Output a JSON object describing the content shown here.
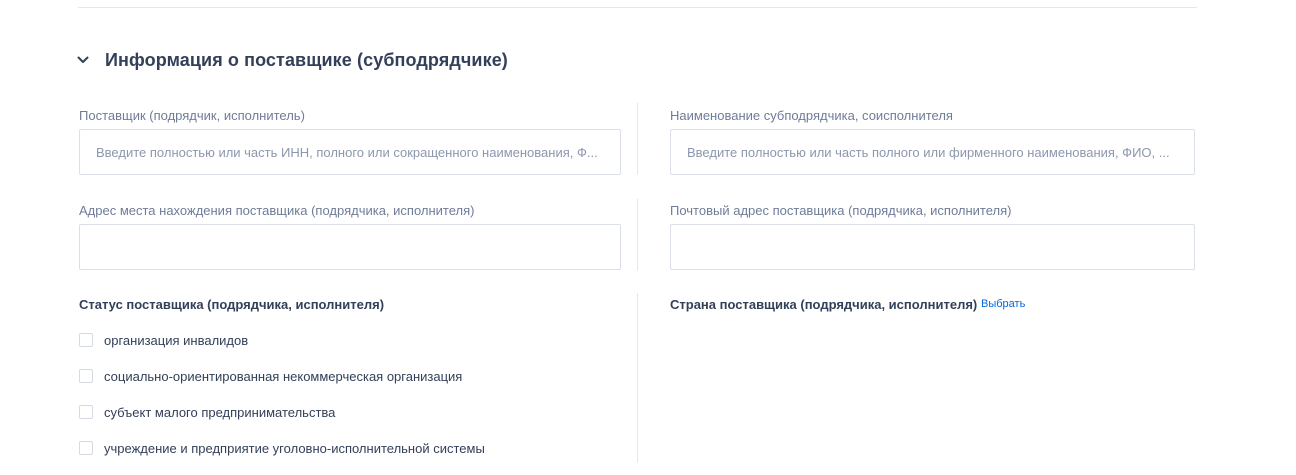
{
  "section": {
    "title": "Информация о поставщике (субподрядчике)",
    "toggle_icon": "chevron-down-icon"
  },
  "supplier": {
    "label": "Поставщик (подрядчик, исполнитель)",
    "placeholder": "Введите полностью или часть ИНН, полного или сокращенного наименования, Ф...",
    "value": ""
  },
  "subcontractor": {
    "label": "Наименование субподрядчика, соисполнителя",
    "placeholder": "Введите полностью или часть полного или фирменного наименования, ФИО, ...",
    "value": ""
  },
  "supplier_address": {
    "label": "Адрес места нахождения поставщика (подрядчика, исполнителя)",
    "value": ""
  },
  "postal_address": {
    "label": "Почтовый адрес поставщика (подрядчика, исполнителя)",
    "value": ""
  },
  "status": {
    "label": "Статус поставщика (подрядчика, исполнителя)",
    "options": [
      {
        "label": "организация инвалидов",
        "checked": false
      },
      {
        "label": "социально-ориентированная некоммерческая организация",
        "checked": false
      },
      {
        "label": "субъект малого предпринимательства",
        "checked": false
      },
      {
        "label": "учреждение и предприятие уголовно-исполнительной системы",
        "checked": false
      }
    ]
  },
  "country": {
    "label": "Страна поставщика (подрядчика, исполнителя)",
    "select_link": "Выбрать"
  },
  "colors": {
    "text_primary": "#334059",
    "text_secondary": "#6f7c98",
    "link": "#0065dd",
    "border": "#dadfe8"
  }
}
